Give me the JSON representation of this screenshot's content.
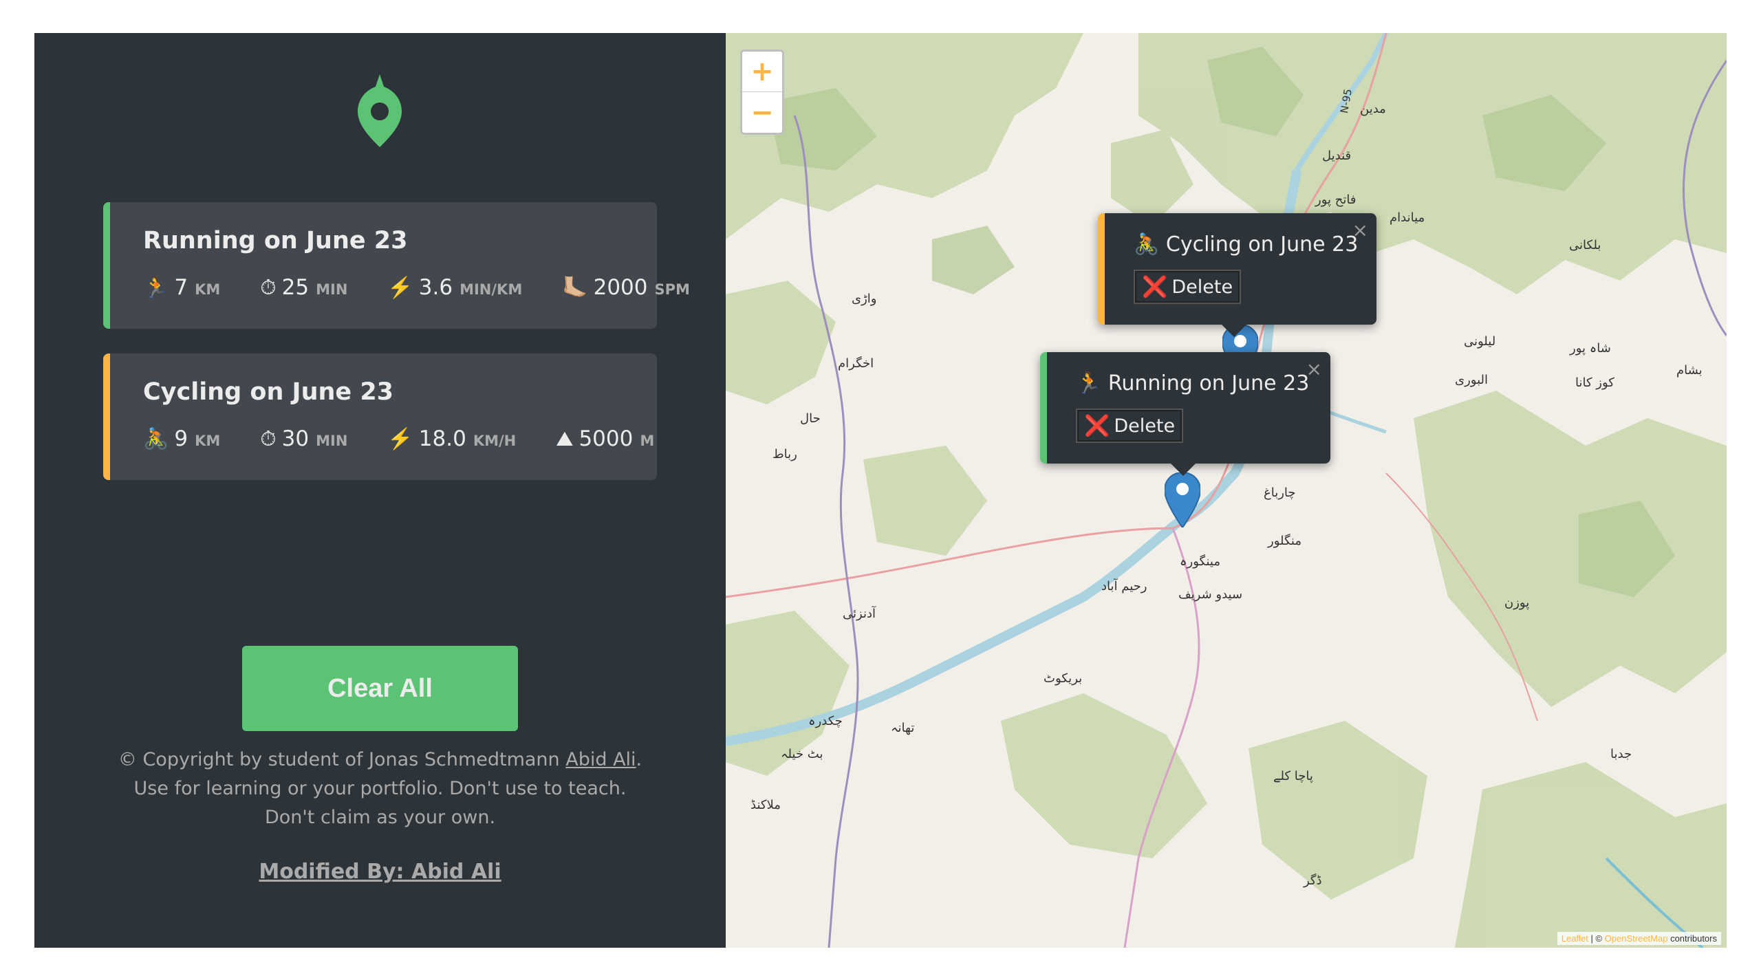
{
  "sidebar": {
    "workouts": [
      {
        "type": "running",
        "title": "Running on June 23",
        "details": [
          {
            "icon": "🏃",
            "value": "7",
            "unit": "km"
          },
          {
            "icon": "⏱",
            "value": "25",
            "unit": "min"
          },
          {
            "icon": "⚡️",
            "value": "3.6",
            "unit": "min/km"
          },
          {
            "icon": "🦶🏼",
            "value": "2000",
            "unit": "spm"
          }
        ]
      },
      {
        "type": "cycling",
        "title": "Cycling on June 23",
        "details": [
          {
            "icon": "🚴",
            "value": "9",
            "unit": "km"
          },
          {
            "icon": "⏱",
            "value": "30",
            "unit": "min"
          },
          {
            "icon": "⚡️",
            "value": "18.0",
            "unit": "km/h"
          },
          {
            "icon": "⛰",
            "value": "5000",
            "unit": "m"
          }
        ]
      }
    ],
    "clear_label": "Clear All",
    "copyright_pre": "© Copyright by student of Jonas Schmedtmann ",
    "copyright_link": "Abid Ali",
    "copyright_post": ". Use for learning or your portfolio. Don't use to teach. Don't claim as your own.",
    "modified_label": "Modified By: Abid Ali"
  },
  "map": {
    "zoom_in": "+",
    "zoom_out": "−",
    "popups": {
      "cycling": {
        "icon": "🚴",
        "title": "Cycling on June 23",
        "close": "×",
        "delete_icon": "❌",
        "delete_label": "Delete"
      },
      "running": {
        "icon": "🏃",
        "title": "Running on June 23",
        "close": "×",
        "delete_icon": "❌",
        "delete_label": "Delete"
      }
    },
    "attribution": {
      "leaflet": "Leaflet",
      "sep": " | © ",
      "osm": "OpenStreetMap",
      "rest": " contributors"
    },
    "places": [
      "مدین",
      "قندیل",
      "فاتح پور",
      "میاندام",
      "بلکانی",
      "واڑی",
      "لیلونی",
      "شاہ پور",
      "البوری",
      "کوز کانا",
      "بشام",
      "اخگرام",
      "حال",
      "رباط",
      "چارباغ",
      "منگلور",
      "مینگورہ",
      "رحیم آباد",
      "سیدو شریف",
      "پوزن",
      "آدنزئی",
      "بریکوٹ",
      "چکدرہ",
      "تھانہ",
      "بٹ خیلہ",
      "جدبا",
      "پاچا کلے",
      "ملاکنڈ",
      "ڈگر",
      "N-95"
    ]
  }
}
